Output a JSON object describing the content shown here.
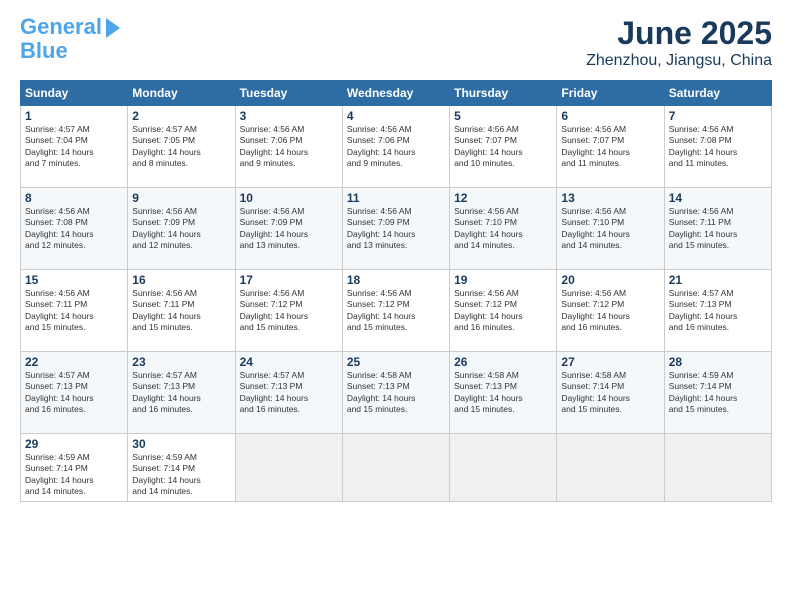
{
  "header": {
    "logo_line1": "General",
    "logo_line2": "Blue",
    "month": "June 2025",
    "location": "Zhenzhou, Jiangsu, China"
  },
  "weekdays": [
    "Sunday",
    "Monday",
    "Tuesday",
    "Wednesday",
    "Thursday",
    "Friday",
    "Saturday"
  ],
  "weeks": [
    [
      {
        "day": "1",
        "info": "Sunrise: 4:57 AM\nSunset: 7:04 PM\nDaylight: 14 hours\nand 7 minutes."
      },
      {
        "day": "2",
        "info": "Sunrise: 4:57 AM\nSunset: 7:05 PM\nDaylight: 14 hours\nand 8 minutes."
      },
      {
        "day": "3",
        "info": "Sunrise: 4:56 AM\nSunset: 7:06 PM\nDaylight: 14 hours\nand 9 minutes."
      },
      {
        "day": "4",
        "info": "Sunrise: 4:56 AM\nSunset: 7:06 PM\nDaylight: 14 hours\nand 9 minutes."
      },
      {
        "day": "5",
        "info": "Sunrise: 4:56 AM\nSunset: 7:07 PM\nDaylight: 14 hours\nand 10 minutes."
      },
      {
        "day": "6",
        "info": "Sunrise: 4:56 AM\nSunset: 7:07 PM\nDaylight: 14 hours\nand 11 minutes."
      },
      {
        "day": "7",
        "info": "Sunrise: 4:56 AM\nSunset: 7:08 PM\nDaylight: 14 hours\nand 11 minutes."
      }
    ],
    [
      {
        "day": "8",
        "info": "Sunrise: 4:56 AM\nSunset: 7:08 PM\nDaylight: 14 hours\nand 12 minutes."
      },
      {
        "day": "9",
        "info": "Sunrise: 4:56 AM\nSunset: 7:09 PM\nDaylight: 14 hours\nand 12 minutes."
      },
      {
        "day": "10",
        "info": "Sunrise: 4:56 AM\nSunset: 7:09 PM\nDaylight: 14 hours\nand 13 minutes."
      },
      {
        "day": "11",
        "info": "Sunrise: 4:56 AM\nSunset: 7:09 PM\nDaylight: 14 hours\nand 13 minutes."
      },
      {
        "day": "12",
        "info": "Sunrise: 4:56 AM\nSunset: 7:10 PM\nDaylight: 14 hours\nand 14 minutes."
      },
      {
        "day": "13",
        "info": "Sunrise: 4:56 AM\nSunset: 7:10 PM\nDaylight: 14 hours\nand 14 minutes."
      },
      {
        "day": "14",
        "info": "Sunrise: 4:56 AM\nSunset: 7:11 PM\nDaylight: 14 hours\nand 15 minutes."
      }
    ],
    [
      {
        "day": "15",
        "info": "Sunrise: 4:56 AM\nSunset: 7:11 PM\nDaylight: 14 hours\nand 15 minutes."
      },
      {
        "day": "16",
        "info": "Sunrise: 4:56 AM\nSunset: 7:11 PM\nDaylight: 14 hours\nand 15 minutes."
      },
      {
        "day": "17",
        "info": "Sunrise: 4:56 AM\nSunset: 7:12 PM\nDaylight: 14 hours\nand 15 minutes."
      },
      {
        "day": "18",
        "info": "Sunrise: 4:56 AM\nSunset: 7:12 PM\nDaylight: 14 hours\nand 15 minutes."
      },
      {
        "day": "19",
        "info": "Sunrise: 4:56 AM\nSunset: 7:12 PM\nDaylight: 14 hours\nand 16 minutes."
      },
      {
        "day": "20",
        "info": "Sunrise: 4:56 AM\nSunset: 7:12 PM\nDaylight: 14 hours\nand 16 minutes."
      },
      {
        "day": "21",
        "info": "Sunrise: 4:57 AM\nSunset: 7:13 PM\nDaylight: 14 hours\nand 16 minutes."
      }
    ],
    [
      {
        "day": "22",
        "info": "Sunrise: 4:57 AM\nSunset: 7:13 PM\nDaylight: 14 hours\nand 16 minutes."
      },
      {
        "day": "23",
        "info": "Sunrise: 4:57 AM\nSunset: 7:13 PM\nDaylight: 14 hours\nand 16 minutes."
      },
      {
        "day": "24",
        "info": "Sunrise: 4:57 AM\nSunset: 7:13 PM\nDaylight: 14 hours\nand 16 minutes."
      },
      {
        "day": "25",
        "info": "Sunrise: 4:58 AM\nSunset: 7:13 PM\nDaylight: 14 hours\nand 15 minutes."
      },
      {
        "day": "26",
        "info": "Sunrise: 4:58 AM\nSunset: 7:13 PM\nDaylight: 14 hours\nand 15 minutes."
      },
      {
        "day": "27",
        "info": "Sunrise: 4:58 AM\nSunset: 7:14 PM\nDaylight: 14 hours\nand 15 minutes."
      },
      {
        "day": "28",
        "info": "Sunrise: 4:59 AM\nSunset: 7:14 PM\nDaylight: 14 hours\nand 15 minutes."
      }
    ],
    [
      {
        "day": "29",
        "info": "Sunrise: 4:59 AM\nSunset: 7:14 PM\nDaylight: 14 hours\nand 14 minutes."
      },
      {
        "day": "30",
        "info": "Sunrise: 4:59 AM\nSunset: 7:14 PM\nDaylight: 14 hours\nand 14 minutes."
      },
      null,
      null,
      null,
      null,
      null
    ]
  ]
}
